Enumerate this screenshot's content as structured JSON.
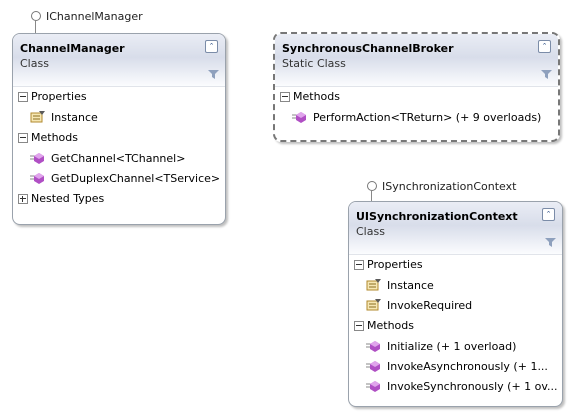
{
  "interfaces": {
    "channel_manager": "IChannelManager",
    "sync_context": "ISynchronizationContext"
  },
  "channel_manager": {
    "name": "ChannelManager",
    "stereotype": "Class",
    "sections": {
      "properties": "Properties",
      "methods": "Methods",
      "nested": "Nested Types"
    },
    "properties": [
      "Instance"
    ],
    "methods": [
      "GetChannel<TChannel>",
      "GetDuplexChannel<TService>"
    ]
  },
  "broker": {
    "name": "SynchronousChannelBroker",
    "stereotype": "Static Class",
    "sections": {
      "methods": "Methods"
    },
    "methods": [
      "PerformAction<TReturn> (+ 9 overloads)"
    ]
  },
  "ui_context": {
    "name": "UISynchronizationContext",
    "stereotype": "Class",
    "sections": {
      "properties": "Properties",
      "methods": "Methods"
    },
    "properties": [
      "Instance",
      "InvokeRequired"
    ],
    "methods": [
      "Initialize (+ 1 overload)",
      "InvokeAsynchronously (+ 1...",
      "InvokeSynchronously (+ 1 ov..."
    ]
  },
  "colors": {
    "method_icon": "#b04fc4",
    "property_icon": "#c89a2a",
    "header_gradient": "#d8ddea"
  }
}
